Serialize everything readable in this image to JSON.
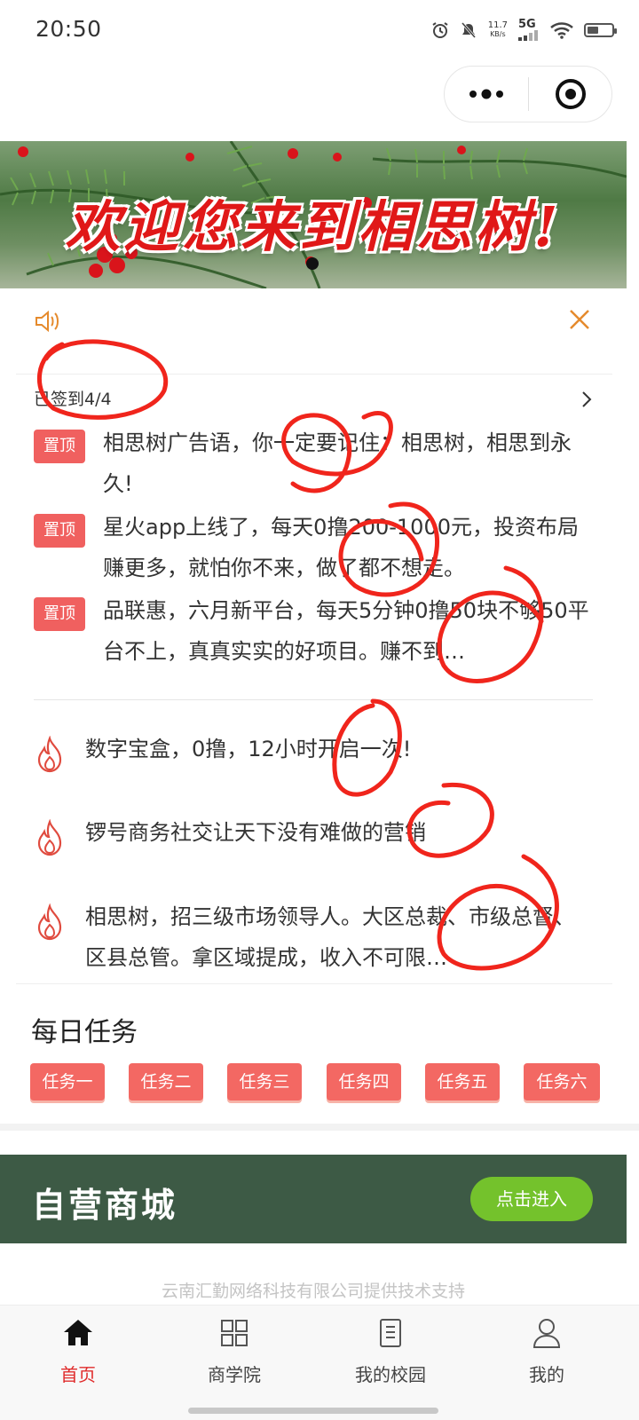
{
  "status_bar": {
    "time": "20:50",
    "net_speed_value": "11.7",
    "net_speed_unit": "KB/s",
    "network": "5G",
    "icons": [
      "alarm-icon",
      "mute-icon",
      "signal-icon",
      "wifi-icon",
      "battery-icon"
    ]
  },
  "capsule": {
    "more_icon": "more-dots-icon",
    "close_icon": "target-close-icon"
  },
  "banner": {
    "text": "欢迎您来到相思树!",
    "indicator_active": 0
  },
  "notice": {
    "speaker_icon": "speaker-icon",
    "close_icon": "close-icon"
  },
  "signin": {
    "text": "已签到4/4"
  },
  "pinned": {
    "badge": "置顶",
    "items": [
      {
        "text": "相思树广告语，你一定要记住：相思树，相思到永久!"
      },
      {
        "text": "星火app上线了，每天0撸200-1000元，投资布局赚更多，就怕你不来，做了都不想走。"
      },
      {
        "text": "品联惠，六月新平台，每天5分钟0撸50块不够50平台不上，真真实实的好项目。赚不到…"
      }
    ]
  },
  "hot": {
    "icon": "flame-icon",
    "items": [
      {
        "text": "数字宝盒，0撸，12小时开启一次!"
      },
      {
        "text": "锣号商务社交让天下没有难做的营销"
      },
      {
        "text": "相思树，招三级市场领导人。大区总裁、市级总督、区县总管。拿区域提成，收入不可限…"
      }
    ]
  },
  "daily_tasks": {
    "title": "每日任务",
    "buttons": [
      "任务一",
      "任务二",
      "任务三",
      "任务四",
      "任务五",
      "任务六"
    ]
  },
  "store": {
    "title": "自营商城",
    "button": "点击进入"
  },
  "support_text": "云南汇勤网络科技有限公司提供技术支持",
  "tabbar": {
    "tabs": [
      {
        "label": "首页",
        "icon": "home-icon",
        "active": true
      },
      {
        "label": "商学院",
        "icon": "grid-icon",
        "active": false
      },
      {
        "label": "我的校园",
        "icon": "document-icon",
        "active": false
      },
      {
        "label": "我的",
        "icon": "user-icon",
        "active": false
      }
    ]
  },
  "colors": {
    "accent_red": "#e02b2b",
    "badge_red": "#f0605f",
    "store_green": "#3d5a45",
    "store_button": "#74c22c",
    "scribble": "#f0251c"
  }
}
